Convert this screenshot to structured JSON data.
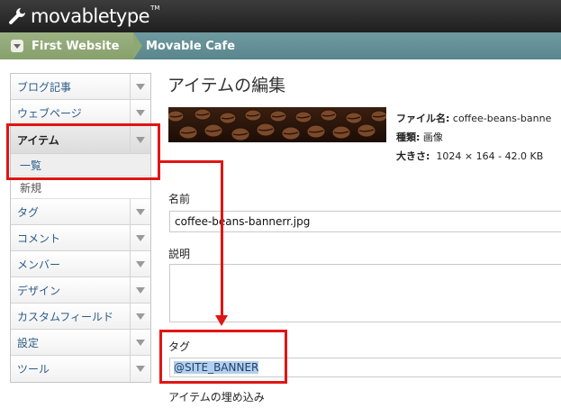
{
  "brand": {
    "name": "movabletype",
    "tm": "TM"
  },
  "breadcrumb": {
    "website": "First Website",
    "blog": "Movable Cafe"
  },
  "sidebar": {
    "items": [
      {
        "label": "ブログ記事"
      },
      {
        "label": "ウェブページ"
      },
      {
        "label": "アイテム"
      },
      {
        "label": "タグ"
      },
      {
        "label": "コメント"
      },
      {
        "label": "メンバー"
      },
      {
        "label": "デザイン"
      },
      {
        "label": "カスタムフィールド"
      },
      {
        "label": "設定"
      },
      {
        "label": "ツール"
      }
    ],
    "sub_items": [
      {
        "label": "一覧"
      },
      {
        "label": "新規"
      }
    ]
  },
  "main": {
    "title": "アイテムの編集",
    "file": {
      "name_label": "ファイル名:",
      "name_value": "coffee-beans-banne",
      "type_label": "種類:",
      "type_value": "画像",
      "size_label": "大きさ:",
      "size_value": "1024 × 164 - 42.0 KB"
    },
    "name_label": "名前",
    "name_value": "coffee-beans-bannerr.jpg",
    "desc_label": "説明",
    "desc_value": "",
    "tag_label": "タグ",
    "tag_value": "@SITE_BANNER",
    "embed_label": "アイテムの埋め込み"
  },
  "colors": {
    "highlight": "#e01515",
    "link": "#2d5c89",
    "crumb_website": "#8ea874",
    "crumb_bar": "#5f8a91"
  }
}
